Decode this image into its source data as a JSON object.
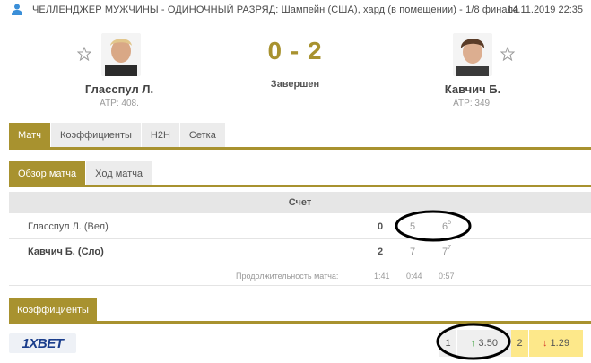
{
  "header": {
    "tournament": "ЧЕЛЛЕНДЖЕР МУЖЧИНЫ - ОДИНОЧНЫЙ РАЗРЯД: Шампейн (США), хард (в помещении) - 1/8 финала",
    "datetime": "14.11.2019 22:35"
  },
  "match": {
    "home": {
      "name": "Гласспул Л.",
      "rank": "ATP: 408."
    },
    "away": {
      "name": "Кавчич Б.",
      "rank": "ATP: 349."
    },
    "score": "0 - 2",
    "status": "Завершен"
  },
  "tabs_main": [
    "Матч",
    "Коэффициенты",
    "H2H",
    "Сетка"
  ],
  "tabs_sub": [
    "Обзор матча",
    "Ход матча"
  ],
  "score_table": {
    "header": "Счет",
    "rows": [
      {
        "player": "Гласспул Л. (Вел)",
        "total": "0",
        "set1": "5",
        "set2": "6",
        "set2_tb": "5"
      },
      {
        "player": "Кавчич Б. (Сло)",
        "total": "2",
        "set1": "7",
        "set2": "7",
        "set2_tb": "7"
      }
    ],
    "duration_label": "Продолжительность матча:",
    "durations": [
      "1:41",
      "0:44",
      "0:57"
    ]
  },
  "odds": {
    "tab_label": "Коэффициенты",
    "bookmaker": "1XBET",
    "home_num": "1",
    "home_odd": "3.50",
    "away_num": "2",
    "away_odd": "1.29"
  },
  "colors": {
    "accent": "#a8922f",
    "odds_highlight": "#fde88a",
    "annotation": "#000000"
  }
}
